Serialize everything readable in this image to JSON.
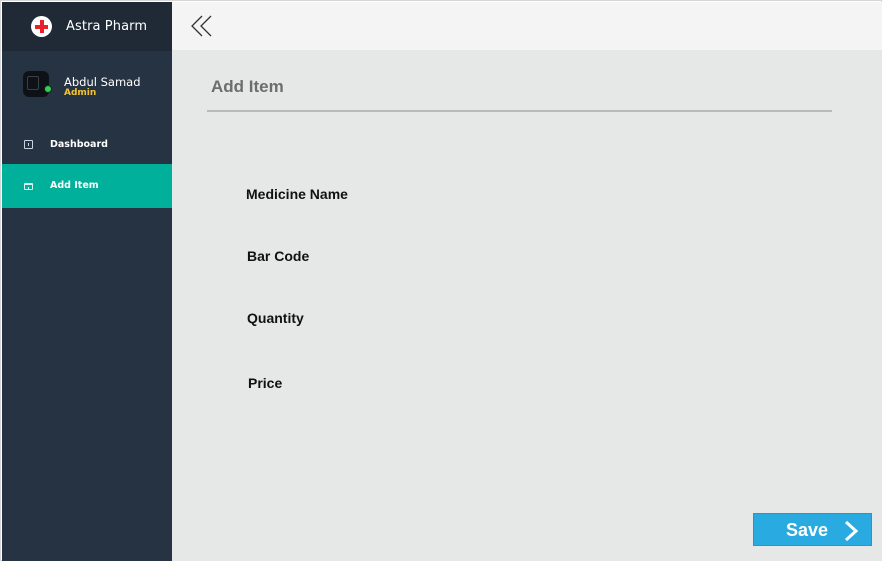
{
  "app": {
    "name": "Astra Pharm"
  },
  "user": {
    "name": "Abdul Samad",
    "role": "Admin"
  },
  "sidebar": {
    "items": [
      {
        "label": "Dashboard",
        "icon": "dashboard-icon",
        "active": false
      },
      {
        "label": "Add Item",
        "icon": "cart-icon",
        "active": true
      }
    ]
  },
  "topbar": {
    "collapse_icon": "double-chevron-left-icon"
  },
  "main": {
    "title": "Add Item",
    "fields": [
      {
        "label": "Medicine Name"
      },
      {
        "label": "Bar Code"
      },
      {
        "label": "Quantity"
      },
      {
        "label": "Price"
      }
    ],
    "save_label": "Save",
    "save_icon": "chevron-right-icon"
  },
  "colors": {
    "sidebar_bg": "#263343",
    "brand_bg": "#1f2a36",
    "active_item": "#00b09b",
    "main_bg": "#e6e7e7",
    "save_button": "#29abe2",
    "role_text": "#f4c430",
    "online_status": "#2fd24a"
  }
}
